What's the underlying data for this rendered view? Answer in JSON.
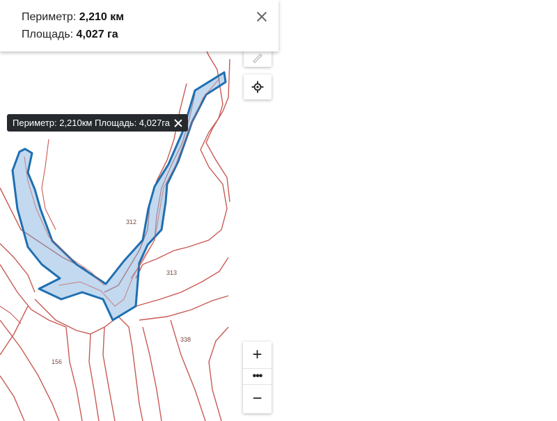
{
  "info_panel": {
    "perimeter_label": "Периметр:",
    "perimeter_value": "2,210 км",
    "area_label": "Площадь:",
    "area_value": "4,027 га"
  },
  "tooltip": {
    "text": "Периметр: 2,210км Площадь: 4,027га"
  },
  "parcels": {
    "p312": "312",
    "p313": "313",
    "p338": "338",
    "p156": "156"
  },
  "controls": {
    "zoom_in": "+",
    "zoom_out": "−",
    "more": "•••"
  },
  "colors": {
    "parcel_border": "#c85a55",
    "selection_stroke": "#1f6fb0",
    "selection_fill": "#78aadc",
    "tooltip_bg": "#262a2e"
  },
  "icons": {
    "close": "close-icon",
    "ruler": "ruler-icon",
    "locate": "crosshair-icon",
    "tooltip_close": "close-icon"
  }
}
